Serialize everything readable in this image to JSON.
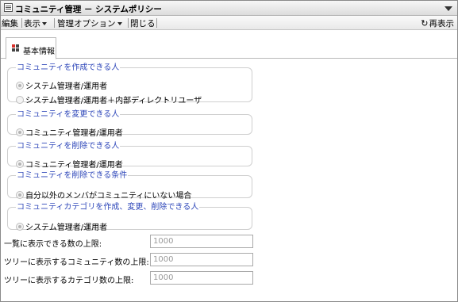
{
  "window": {
    "title": "コミュニティ管理 － システムポリシー"
  },
  "menu": {
    "edit": "編集",
    "view": "表示",
    "admin_options": "管理オプション",
    "close": "閉じる",
    "reload": "再表示"
  },
  "tabs": [
    {
      "label": "基本情報"
    }
  ],
  "groups": [
    {
      "legend": "コミュニティを作成できる人",
      "options": [
        {
          "label": "システム管理者/運用者",
          "selected": true
        },
        {
          "label": "システム管理者/運用者＋内部ディレクトリユーザ",
          "selected": false
        }
      ]
    },
    {
      "legend": "コミュニティを変更できる人",
      "options": [
        {
          "label": "コミュニティ管理者/運用者",
          "selected": true
        }
      ]
    },
    {
      "legend": "コミュニティを削除できる人",
      "options": [
        {
          "label": "コミュニティ管理者/運用者",
          "selected": true
        }
      ]
    },
    {
      "legend": "コミュニティを削除できる条件",
      "options": [
        {
          "label": "自分以外のメンバがコミュニティにいない場合",
          "selected": true
        }
      ]
    },
    {
      "legend": "コミュニティカテゴリを作成、変更、削除できる人",
      "options": [
        {
          "label": "システム管理者/運用者",
          "selected": true
        }
      ]
    }
  ],
  "fields": [
    {
      "label": "一覧に表示できる数の上限:",
      "value": "1000"
    },
    {
      "label": "ツリーに表示するコミュニティ数の上限:",
      "value": "1000"
    },
    {
      "label": "ツリーに表示するカテゴリ数の上限:",
      "value": "1000"
    }
  ],
  "colors": {
    "legend_text": "#2d46b9",
    "tab_icon_red": "#d8312b",
    "tab_icon_dark": "#444444"
  }
}
